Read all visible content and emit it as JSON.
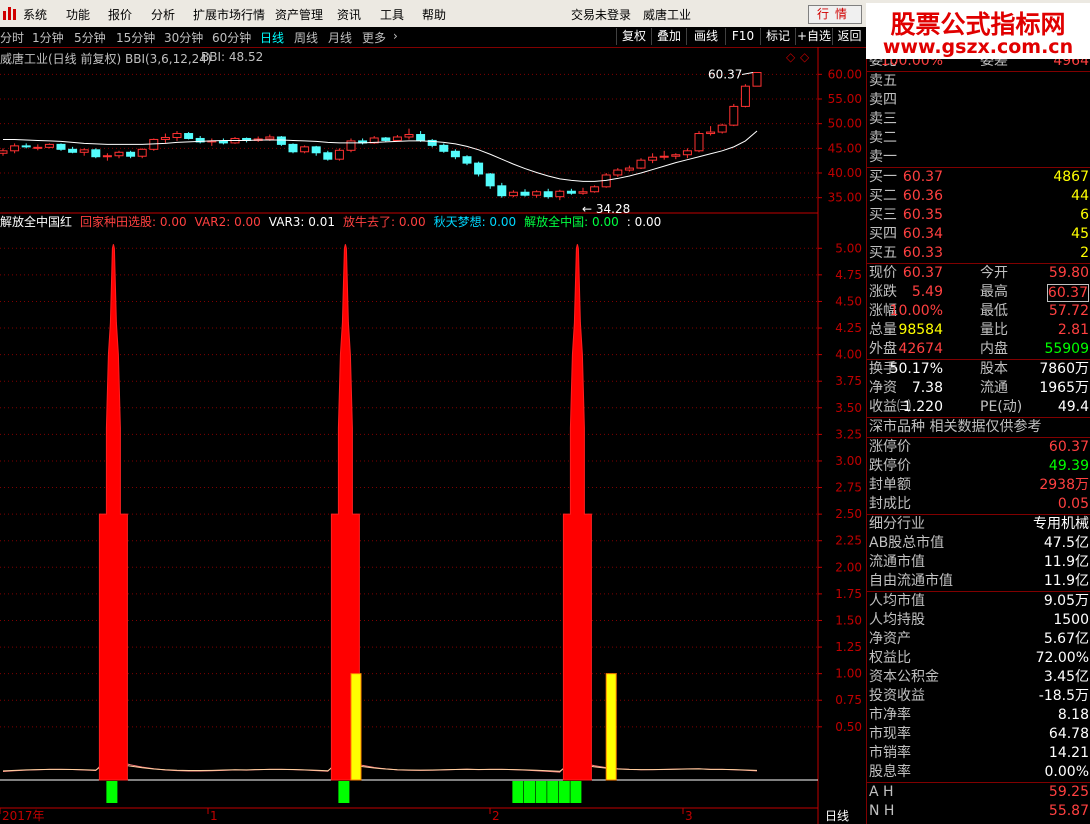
{
  "app": {
    "menu": [
      "系统",
      "功能",
      "报价",
      "分析",
      "扩展市场行情",
      "资产管理",
      "资讯",
      "工具",
      "帮助"
    ],
    "login_status": "交易未登录",
    "stock_name": "威唐工业",
    "mode_button": "行情",
    "banner_title": "股票公式指标网",
    "banner_url": "www.gszx.com.cn"
  },
  "toolbar": {
    "periods": [
      "分时",
      "1分钟",
      "5分钟",
      "15分钟",
      "30分钟",
      "60分钟",
      "日线",
      "周线",
      "月线",
      "更多"
    ],
    "active_period": "日线",
    "buttons": [
      "复权",
      "叠加",
      "画线",
      "F10",
      "标记",
      "+自选",
      "返回"
    ]
  },
  "main_chart": {
    "title": "威唐工业(日线 前复权) BBI(3,6,12,24)",
    "bbi_label": "BBI: 48.52",
    "high_label": "60.37",
    "low_label": "34.28",
    "y_ticks": [
      "60.00",
      "55.00",
      "50.00",
      "45.00",
      "40.00",
      "35.00"
    ]
  },
  "chart_data": [
    {
      "type": "candlestick",
      "title": "威唐工业(日线 前复权) BBI(3,6,12,24)",
      "yticks": [
        60,
        55,
        50,
        45,
        40,
        35
      ],
      "ylim": [
        32.5,
        62.5
      ],
      "series": [
        {
          "name": "K",
          "ohlc": [
            [
              44,
              45,
              43.5,
              44.5
            ],
            [
              44.5,
              46,
              44,
              45.5
            ],
            [
              45.5,
              46,
              45,
              45.4
            ],
            [
              45,
              45.8,
              44.6,
              45.2
            ],
            [
              45.2,
              46,
              45,
              45.8
            ],
            [
              45.8,
              46,
              44.5,
              44.8
            ],
            [
              44.8,
              45.3,
              44,
              44.2
            ],
            [
              44.2,
              45,
              43.5,
              44.7
            ],
            [
              44.7,
              45,
              43,
              43.3
            ],
            [
              43.3,
              44,
              42.5,
              43.5
            ],
            [
              43.5,
              44.5,
              43,
              44.2
            ],
            [
              44.2,
              44.5,
              43,
              43.4
            ],
            [
              43.4,
              45,
              43,
              44.8
            ],
            [
              44.8,
              47,
              44.5,
              46.8
            ],
            [
              46.8,
              48,
              46,
              47.2
            ],
            [
              47.2,
              48.5,
              46.5,
              48
            ],
            [
              48,
              48.3,
              46.8,
              47
            ],
            [
              47,
              47.5,
              46,
              46.3
            ],
            [
              46.3,
              47,
              45.5,
              46.5
            ],
            [
              46.5,
              47,
              45.8,
              46.1
            ],
            [
              46.1,
              47.3,
              45.9,
              47
            ],
            [
              47,
              47.2,
              46.2,
              46.6
            ],
            [
              46.6,
              47.4,
              46.3,
              46.9
            ],
            [
              46.9,
              47.8,
              46.5,
              47.3
            ],
            [
              47.3,
              47.5,
              45.5,
              45.8
            ],
            [
              45.8,
              46,
              44,
              44.3
            ],
            [
              44.3,
              45.6,
              44,
              45.3
            ],
            [
              45.3,
              45.5,
              43.5,
              44.1
            ],
            [
              44.1,
              44.5,
              42.5,
              42.8
            ],
            [
              42.8,
              45,
              42.5,
              44.6
            ],
            [
              44.6,
              47,
              44.2,
              46.5
            ],
            [
              46.5,
              47,
              45.8,
              46.1
            ],
            [
              46.1,
              47.5,
              45.9,
              47.1
            ],
            [
              47.1,
              47.3,
              46.3,
              46.6
            ],
            [
              46.6,
              47.7,
              46.4,
              47.3
            ],
            [
              47.3,
              49,
              46.8,
              47.8
            ],
            [
              47.8,
              48.5,
              46.3,
              46.6
            ],
            [
              46.6,
              46.9,
              45.2,
              45.6
            ],
            [
              45.6,
              46,
              44.1,
              44.4
            ],
            [
              44.4,
              44.8,
              42.8,
              43.3
            ],
            [
              43.3,
              43.6,
              41.6,
              42
            ],
            [
              42,
              42.3,
              39.3,
              39.8
            ],
            [
              39.8,
              40,
              36.8,
              37.4
            ],
            [
              37.4,
              38,
              35,
              35.4
            ],
            [
              35.4,
              36.5,
              35.1,
              36.1
            ],
            [
              36.1,
              36.7,
              35.2,
              35.5
            ],
            [
              35.5,
              36.5,
              35,
              36.2
            ],
            [
              36.2,
              36.8,
              34.8,
              35.2
            ],
            [
              35.2,
              36.6,
              34.5,
              36.3
            ],
            [
              36.3,
              36.8,
              35.6,
              35.9
            ],
            [
              35.9,
              37,
              35.6,
              36.2
            ],
            [
              36.2,
              37.5,
              36,
              37.2
            ],
            [
              37.2,
              40,
              37,
              39.6
            ],
            [
              39.6,
              41,
              39.2,
              40.6
            ],
            [
              40.6,
              41.5,
              40.3,
              41
            ],
            [
              41,
              43,
              40.8,
              42.6
            ],
            [
              42.6,
              44,
              42,
              43.2
            ],
            [
              43.2,
              44.5,
              42.7,
              43.4
            ],
            [
              43.4,
              44,
              42.8,
              43.7
            ],
            [
              43.7,
              45,
              43,
              44.5
            ],
            [
              44.5,
              48.5,
              44.2,
              48
            ],
            [
              48,
              49.5,
              47.6,
              48.3
            ],
            [
              48.3,
              50,
              48,
              49.7
            ],
            [
              49.7,
              54,
              49.5,
              53.5
            ],
            [
              53.5,
              58,
              53.3,
              57.6
            ],
            [
              57.6,
              60.37,
              57.6,
              60.37
            ]
          ]
        },
        {
          "name": "BBI",
          "label": "BBI: 48.52",
          "values": [
            46.8,
            46.8,
            46.7,
            46.6,
            46.5,
            46.4,
            46.2,
            46.0,
            45.9,
            45.8,
            45.8,
            45.8,
            45.8,
            45.9,
            46.0,
            46.2,
            46.3,
            46.4,
            46.5,
            46.6,
            46.6,
            46.6,
            46.7,
            46.7,
            46.7,
            46.6,
            46.5,
            46.4,
            46.2,
            46.1,
            46.1,
            46.1,
            46.2,
            46.3,
            46.4,
            46.5,
            46.5,
            46.4,
            46.2,
            45.9,
            45.4,
            44.7,
            43.8,
            42.8,
            41.8,
            40.9,
            40.1,
            39.4,
            38.8,
            38.5,
            38.3,
            38.3,
            38.5,
            38.9,
            39.4,
            40.0,
            40.7,
            41.4,
            42.1,
            42.7,
            43.3,
            43.9,
            44.5,
            45.3,
            46.5,
            48.52
          ]
        }
      ],
      "annotations": [
        "60.37",
        "34.28"
      ]
    },
    {
      "type": "bar",
      "title": "解放全中国红",
      "legend": [
        {
          "name": "回家种田选股",
          "value": "0.00",
          "color": "#ff4040"
        },
        {
          "name": "VAR2",
          "value": "0.00",
          "color": "#ff4040"
        },
        {
          "name": "VAR3",
          "value": "0.01",
          "color": "#ffffff"
        },
        {
          "name": "放牛去了",
          "value": "0.00",
          "color": "#ff4040"
        },
        {
          "name": "秋天梦想",
          "value": "0.00",
          "color": "#00d8ff"
        },
        {
          "name": "解放全中国",
          "value": "0.00",
          "color": "#00ff40"
        },
        {
          "name": "",
          "value": "0.00",
          "color": "#ffffff"
        }
      ],
      "yticks": [
        5.0,
        4.75,
        4.5,
        4.25,
        4.0,
        3.75,
        3.5,
        3.25,
        3.0,
        2.75,
        2.5,
        2.25,
        2.0,
        1.75,
        1.5,
        1.25,
        1.0,
        0.75,
        0.5
      ],
      "ylim": [
        0,
        5.2
      ],
      "series": [
        {
          "name": "red_spike",
          "shape": "spike",
          "color": "#ff0000",
          "day_index": [
            9,
            29,
            49
          ],
          "values": [
            5.0,
            5.0,
            5.0
          ]
        },
        {
          "name": "yellow",
          "color": "#ffff00",
          "day_index": [
            30,
            52
          ],
          "values": [
            1.0,
            1.0
          ]
        },
        {
          "name": "green",
          "color": "#00ff00",
          "day_index": [
            9,
            29,
            44,
            45,
            46,
            47,
            48,
            49
          ]
        }
      ],
      "x_labels": [
        "2017年",
        "1",
        "2",
        "3"
      ],
      "bottom_tab": "日线"
    }
  ],
  "quote_panel": {
    "weibi": {
      "label": "委比",
      "value": "100.00%",
      "label2": "委差",
      "value2": "4964"
    },
    "sells": [
      {
        "label": "卖五",
        "price": "",
        "vol": ""
      },
      {
        "label": "卖四",
        "price": "",
        "vol": ""
      },
      {
        "label": "卖三",
        "price": "",
        "vol": ""
      },
      {
        "label": "卖二",
        "price": "",
        "vol": ""
      },
      {
        "label": "卖一",
        "price": "",
        "vol": ""
      }
    ],
    "buys": [
      {
        "label": "买一",
        "price": "60.37",
        "vol": "4867"
      },
      {
        "label": "买二",
        "price": "60.36",
        "vol": "44"
      },
      {
        "label": "买三",
        "price": "60.35",
        "vol": "6"
      },
      {
        "label": "买四",
        "price": "60.34",
        "vol": "45"
      },
      {
        "label": "买五",
        "price": "60.33",
        "vol": "2"
      }
    ],
    "quote": [
      {
        "l1": "现价",
        "v1": "60.37",
        "c1": "#ff4040",
        "l2": "今开",
        "v2": "59.80",
        "c2": "#ff4040"
      },
      {
        "l1": "涨跌",
        "v1": "5.49",
        "c1": "#ff4040",
        "l2": "最高",
        "v2": "60.37",
        "c2": "#ff4040",
        "box2": true
      },
      {
        "l1": "涨幅",
        "v1": "10.00%",
        "c1": "#ff4040",
        "l2": "最低",
        "v2": "57.72",
        "c2": "#ff4040"
      },
      {
        "l1": "总量",
        "v1": "98584",
        "c1": "#ffff00",
        "l2": "量比",
        "v2": "2.81",
        "c2": "#ff4040"
      },
      {
        "l1": "外盘",
        "v1": "42674",
        "c1": "#ff4040",
        "l2": "内盘",
        "v2": "55909",
        "c2": "#00ff00"
      }
    ],
    "quote2": [
      {
        "l1": "换手",
        "v1": "50.17%",
        "c1": "#ffffff",
        "l2": "股本",
        "v2": "7860万",
        "c2": "#ffffff"
      },
      {
        "l1": "净资",
        "v1": "7.38",
        "c1": "#ffffff",
        "l2": "流通",
        "v2": "1965万",
        "c2": "#ffffff"
      },
      {
        "l1": "收益㈢",
        "v1": "1.220",
        "c1": "#ffffff",
        "l2": "PE(动)",
        "v2": "49.4",
        "c2": "#ffffff"
      }
    ],
    "market_note": "深市品种  相关数据仅供参考",
    "limits": [
      {
        "label": "涨停价",
        "value": "60.37",
        "color": "#ff4040"
      },
      {
        "label": "跌停价",
        "value": "49.39",
        "color": "#00ff00"
      },
      {
        "label": "封单额",
        "value": "2938万",
        "color": "#ff4040"
      },
      {
        "label": "封成比",
        "value": "0.05",
        "color": "#ff4040"
      }
    ],
    "fundamentals1": [
      {
        "label": "细分行业",
        "value": "专用机械"
      },
      {
        "label": "AB股总市值",
        "value": "47.5亿"
      },
      {
        "label": "流通市值",
        "value": "11.9亿"
      },
      {
        "label": "自由流通市值",
        "value": "11.9亿"
      }
    ],
    "fundamentals2": [
      {
        "label": "人均市值",
        "value": "9.05万"
      },
      {
        "label": "人均持股",
        "value": "1500"
      },
      {
        "label": "净资产",
        "value": "5.67亿"
      },
      {
        "label": "权益比",
        "value": "72.00%"
      },
      {
        "label": "资本公积金",
        "value": "3.45亿"
      },
      {
        "label": "投资收益",
        "value": "-18.5万"
      },
      {
        "label": "市净率",
        "value": "8.18"
      },
      {
        "label": "市现率",
        "value": "64.78"
      },
      {
        "label": "市销率",
        "value": "14.21"
      },
      {
        "label": "股息率",
        "value": "0.00%"
      }
    ],
    "ah": [
      {
        "label": "A H",
        "value": "59.25",
        "color": "#ff4040"
      },
      {
        "label": "N H",
        "value": "55.87",
        "color": "#ff4040"
      }
    ]
  },
  "colors": {
    "up": "#ff3232",
    "down": "#54fcfc",
    "grid": "#800000",
    "axis": "#c00000",
    "bbi": "#ffffff"
  }
}
